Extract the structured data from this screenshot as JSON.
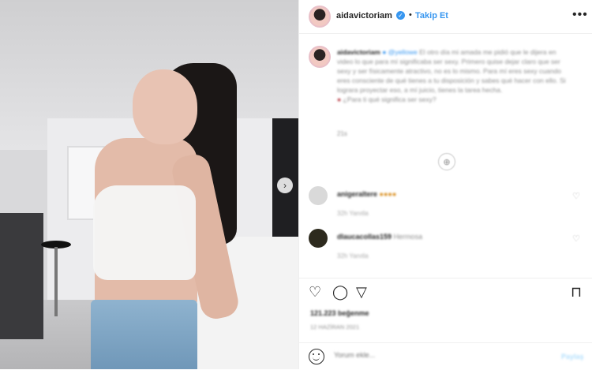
{
  "post": {
    "username": "aidavictoriam",
    "verified_glyph": "✓",
    "dot": "•",
    "follow_label": "Takip Et",
    "more_glyph": "•••",
    "nav_next_glyph": "›"
  },
  "caption": {
    "username": "aidavictoriam",
    "mention": "@yellowe",
    "text": "El otro día mi amada me pidió que le dijera en video lo que para mí significaba ser sexy. Primero quise dejar claro que ser sexy y ser físicamente atractivo, no es lo mismo. Para mí eres sexy cuando eres consciente de qué tienes a tu disposición y sabes qué hacer con ello. Si lograra proyectar eso, a mí juicio, tienes la tarea hecha.",
    "closing": "¿Para ti qué significa ser sexy?",
    "emoji": "●",
    "time": "21s"
  },
  "load_more_glyph": "⊕",
  "comments": [
    {
      "username": "anigeraltere",
      "text": "●●●●",
      "meta": "32h   Yanıtla",
      "heart": "♡",
      "avatar_color": "#d9d9d9"
    },
    {
      "username": "dlaucacollas159",
      "text": "Hermosa",
      "meta": "32h   Yanıtla",
      "heart": "♡",
      "avatar_color": "#2d2a1e"
    }
  ],
  "actions": {
    "like_icon": "♡",
    "comment_icon": "◯",
    "share_icon": "▽",
    "save_icon": "⊓"
  },
  "likes": "121.223 beğenme",
  "date": "12 HAZİRAN 2021",
  "add_comment": {
    "placeholder": "Yorum ekle...",
    "post_label": "Paylaş"
  },
  "colors": {
    "accent": "#3897f0",
    "text": "#262626",
    "muted": "#8e8e8e"
  }
}
